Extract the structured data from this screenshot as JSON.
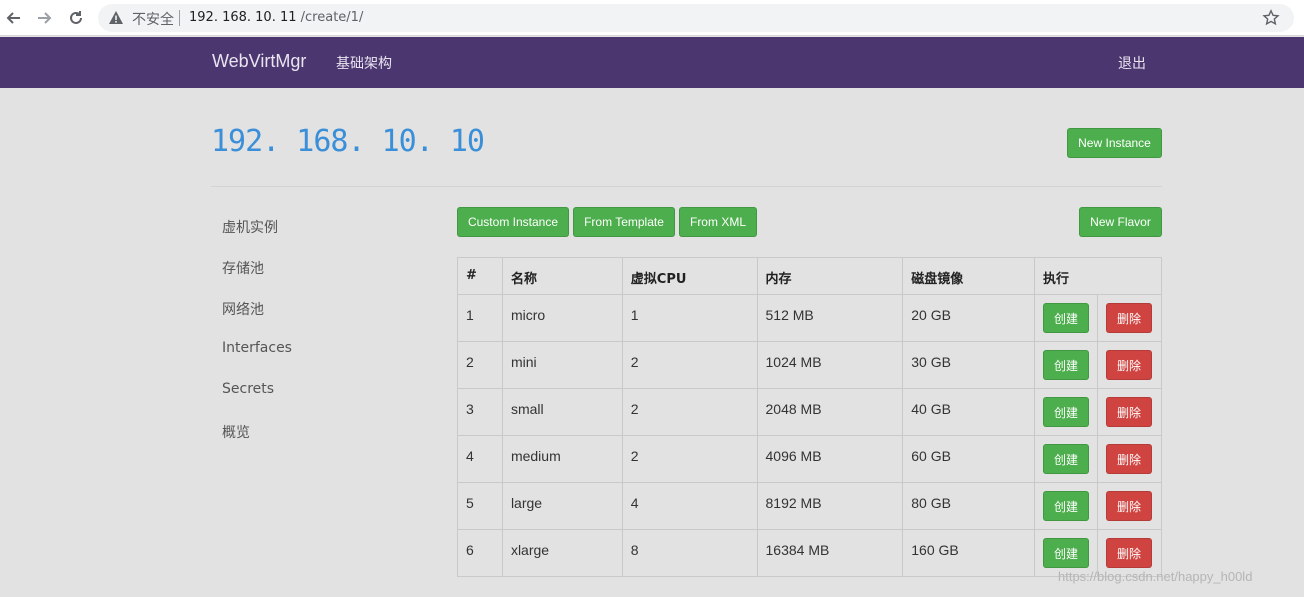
{
  "browser": {
    "insecure_label": "不安全",
    "url_host": "192. 168. 10. 11",
    "url_path": " /create/1/"
  },
  "navbar": {
    "brand": "WebVirtMgr",
    "infrastructure_link": "基础架构",
    "logout": "退出"
  },
  "header": {
    "host_title": "192. 168. 10. 10",
    "new_instance_label": "New Instance"
  },
  "sidebar": {
    "items": [
      {
        "label": "虚机实例"
      },
      {
        "label": "存储池"
      },
      {
        "label": "网络池"
      },
      {
        "label": "Interfaces"
      },
      {
        "label": "Secrets"
      },
      {
        "label": "概览"
      }
    ]
  },
  "actions": {
    "custom_instance": "Custom Instance",
    "from_template": "From Template",
    "from_xml": "From XML",
    "new_flavor": "New Flavor"
  },
  "table": {
    "headers": [
      "#",
      "名称",
      "虚拟CPU",
      "内存",
      "磁盘镜像",
      "执行"
    ],
    "create_label": "创建",
    "delete_label": "删除",
    "rows": [
      {
        "id": "1",
        "name": "micro",
        "vcpu": "1",
        "memory": "512 MB",
        "disk": "20 GB"
      },
      {
        "id": "2",
        "name": "mini",
        "vcpu": "2",
        "memory": "1024 MB",
        "disk": "30 GB"
      },
      {
        "id": "3",
        "name": "small",
        "vcpu": "2",
        "memory": "2048 MB",
        "disk": "40 GB"
      },
      {
        "id": "4",
        "name": "medium",
        "vcpu": "2",
        "memory": "4096 MB",
        "disk": "60 GB"
      },
      {
        "id": "5",
        "name": "large",
        "vcpu": "4",
        "memory": "8192 MB",
        "disk": "80 GB"
      },
      {
        "id": "6",
        "name": "xlarge",
        "vcpu": "8",
        "memory": "16384 MB",
        "disk": "160 GB"
      }
    ]
  },
  "watermark": "https://blog.csdn.net/happy_h00ld",
  "colors": {
    "navbar": "#4b3670",
    "accent_title": "#3a8fd8",
    "success": "#4cae4c",
    "danger": "#cf4440",
    "background": "#e2e2e2"
  }
}
